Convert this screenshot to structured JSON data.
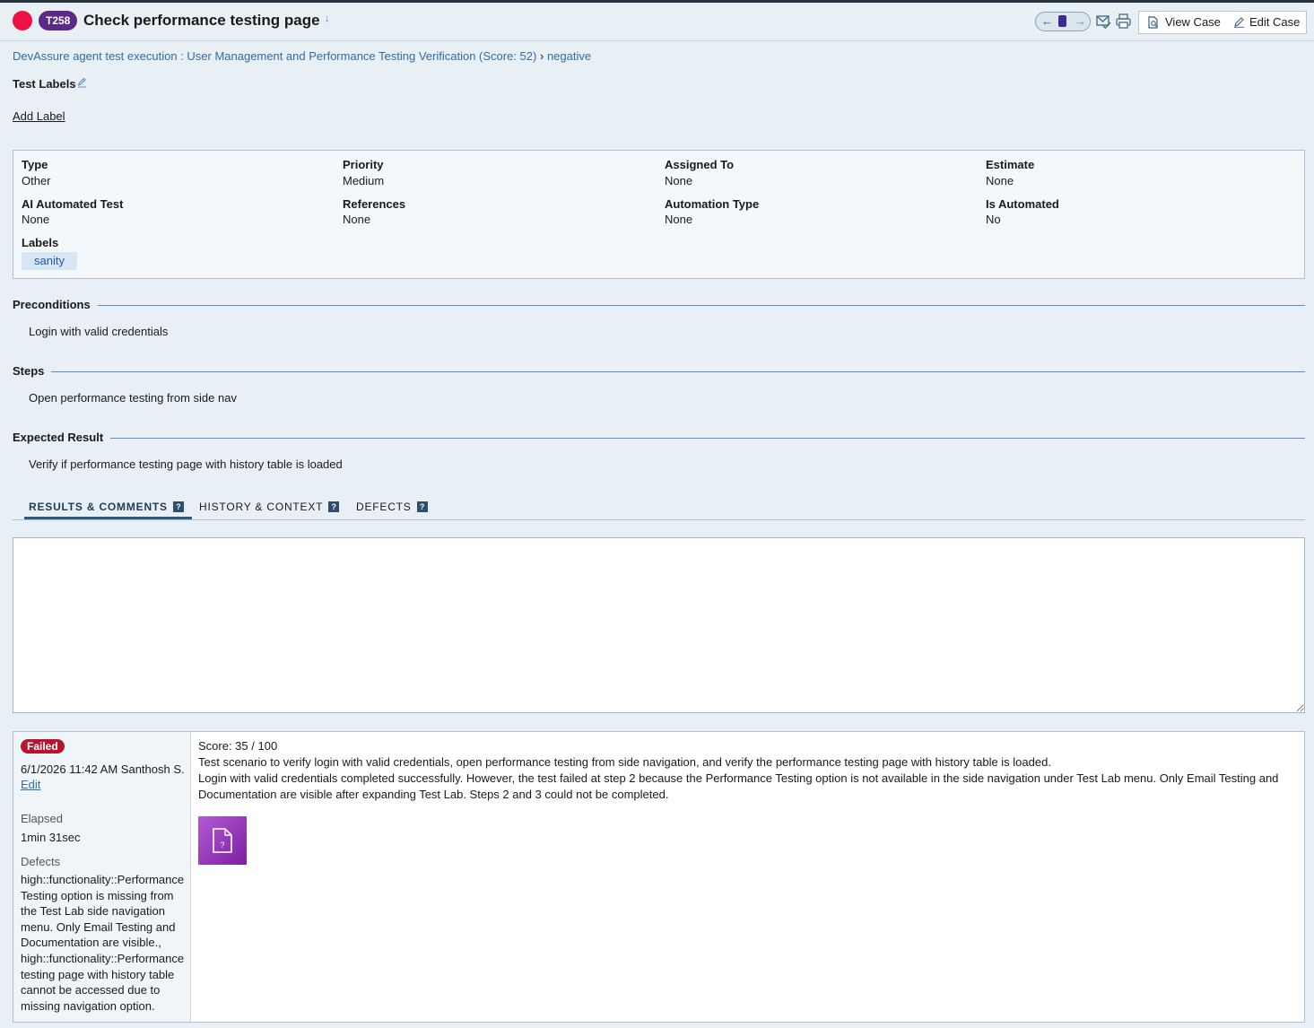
{
  "colors": {
    "status_failed": "#ee1144",
    "badge": "#5b2a86",
    "link": "#2f6da6",
    "failed_badge": "#b5162d",
    "label_chip": "#d6e6f5"
  },
  "header": {
    "case_id": "T258",
    "title": "Check performance testing page",
    "view_case": "View Case",
    "edit_case": "Edit Case",
    "icons": [
      "arrow-left-icon",
      "board-icon",
      "arrow-right-icon",
      "mail-check-icon",
      "printer-icon",
      "search-document-icon",
      "pencil-icon"
    ]
  },
  "breadcrumb": {
    "run": "DevAssure agent test execution : User Management and Performance Testing Verification (Score: 52)",
    "separator": "›",
    "section": "negative"
  },
  "test_labels": {
    "heading": "Test Labels",
    "add_label": "Add Label"
  },
  "properties": {
    "type": {
      "label": "Type",
      "value": "Other"
    },
    "priority": {
      "label": "Priority",
      "value": "Medium"
    },
    "assigned_to": {
      "label": "Assigned To",
      "value": "None"
    },
    "estimate": {
      "label": "Estimate",
      "value": "None"
    },
    "ai_automated": {
      "label": "AI Automated Test",
      "value": "None"
    },
    "references": {
      "label": "References",
      "value": "None"
    },
    "automation_type": {
      "label": "Automation Type",
      "value": "None"
    },
    "is_automated": {
      "label": "Is Automated",
      "value": "No"
    },
    "labels": {
      "label": "Labels",
      "chips": [
        "sanity"
      ]
    }
  },
  "sections": {
    "preconditions": {
      "title": "Preconditions",
      "body": "Login with valid credentials"
    },
    "steps": {
      "title": "Steps",
      "body": "Open performance testing from side nav"
    },
    "expected": {
      "title": "Expected Result",
      "body": "Verify if performance testing page with history table is loaded"
    }
  },
  "tabs": [
    {
      "label": "RESULTS & COMMENTS",
      "active": true
    },
    {
      "label": "HISTORY & CONTEXT",
      "active": false
    },
    {
      "label": "DEFECTS",
      "active": false
    }
  ],
  "help_glyph": "?",
  "comment": {
    "value": ""
  },
  "result": {
    "status": "Failed",
    "timestamp": "6/1/2026 11:42 AM Santhosh S.",
    "edit": "Edit",
    "elapsed_label": "Elapsed",
    "elapsed": "1min 31sec",
    "defects_label": "Defects",
    "defects": "high::functionality::Performance Testing option is missing from the Test Lab side navigation menu. Only Email Testing and Documentation are visible., high::functionality::Performance testing page with history table cannot be accessed due to missing navigation option.",
    "score": "Score: 35 / 100",
    "description": "Test scenario to verify login with valid credentials, open performance testing from side navigation, and verify the performance testing page with history table is loaded.",
    "details": "Login with valid credentials completed successfully. However, the test failed at step 2 because the Performance Testing option is not available in the side navigation under Test Lab menu. Only Email Testing and Documentation are visible after expanding Test Lab. Steps 2 and 3 could not be completed.",
    "attachment_icon": "unknown-file-icon",
    "attachment_glyph": "?"
  }
}
